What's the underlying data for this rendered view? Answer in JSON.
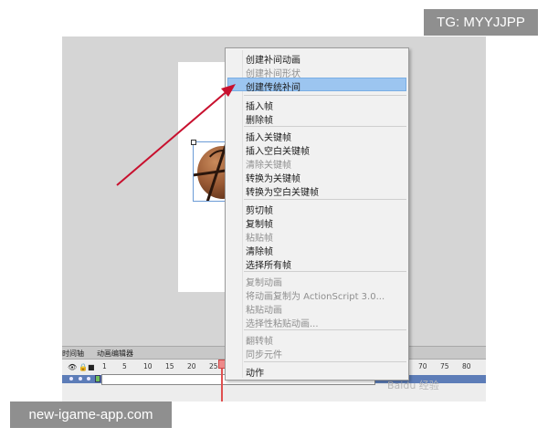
{
  "watermarks": {
    "top": "TG: MYYJJPP",
    "bottom": "new-igame-app.com",
    "timeline_logo": "Baidu 经验"
  },
  "timeline": {
    "tabs": [
      "时间轴",
      "动画编辑器"
    ],
    "ruler": [
      "1",
      "5",
      "10",
      "15",
      "20",
      "25",
      "70",
      "75",
      "80"
    ]
  },
  "menu": {
    "items": [
      {
        "label": "创建补间动画",
        "enabled": true
      },
      {
        "label": "创建补间形状",
        "enabled": false
      },
      {
        "label": "创建传统补间",
        "enabled": true,
        "highlighted": true
      },
      {
        "label": "插入帧",
        "enabled": true
      },
      {
        "label": "删除帧",
        "enabled": true
      },
      {
        "label": "插入关键帧",
        "enabled": true
      },
      {
        "label": "插入空白关键帧",
        "enabled": true
      },
      {
        "label": "清除关键帧",
        "enabled": false
      },
      {
        "label": "转换为关键帧",
        "enabled": true
      },
      {
        "label": "转换为空白关键帧",
        "enabled": true
      },
      {
        "label": "剪切帧",
        "enabled": true
      },
      {
        "label": "复制帧",
        "enabled": true
      },
      {
        "label": "粘贴帧",
        "enabled": false
      },
      {
        "label": "清除帧",
        "enabled": true
      },
      {
        "label": "选择所有帧",
        "enabled": true
      },
      {
        "label": "复制动画",
        "enabled": false
      },
      {
        "label": "将动画复制为 ActionScript 3.0...",
        "enabled": false
      },
      {
        "label": "粘贴动画",
        "enabled": false
      },
      {
        "label": "选择性粘贴动画...",
        "enabled": false
      },
      {
        "label": "翻转帧",
        "enabled": false
      },
      {
        "label": "同步元件",
        "enabled": false
      },
      {
        "label": "动作",
        "enabled": true
      }
    ]
  },
  "colors": {
    "highlight": "#9cc5f0",
    "arrow": "#c8102e"
  }
}
